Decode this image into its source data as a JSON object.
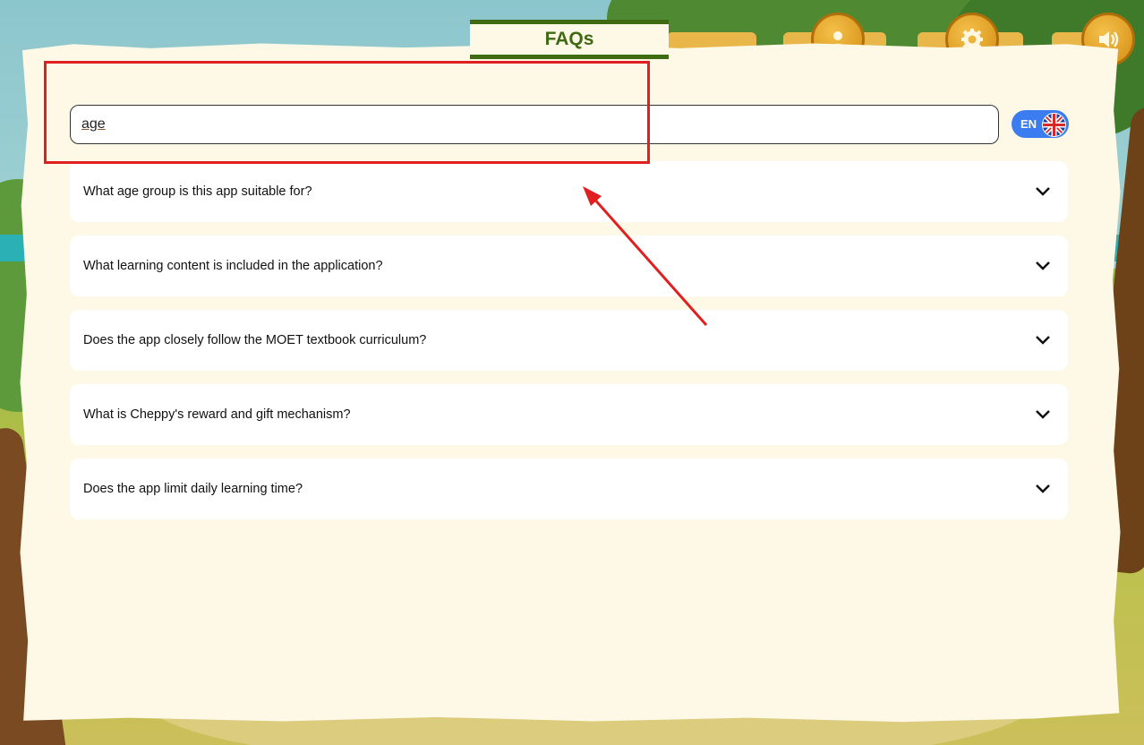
{
  "header": {
    "title": "FAQs"
  },
  "search": {
    "value": "age"
  },
  "language": {
    "code": "EN"
  },
  "faq": {
    "items": [
      {
        "question": "What age group is this app suitable for?"
      },
      {
        "question": "What learning content is included in the application?"
      },
      {
        "question": "Does the app closely follow the MOET textbook curriculum?"
      },
      {
        "question": "What is Cheppy's reward and gift mechanism?"
      },
      {
        "question": "Does the app limit daily learning time?"
      }
    ]
  },
  "icons": {
    "profile": "profile-icon",
    "settings": "gear-icon",
    "sound": "speaker-icon",
    "expand": "chevron-down-icon",
    "flag": "uk-flag-icon"
  },
  "colors": {
    "paper": "#fef9e6",
    "title_green": "#3f6a12",
    "lang_blue": "#3b7df0",
    "annotation_red": "#e02020",
    "button_orange": "#d48d12"
  }
}
